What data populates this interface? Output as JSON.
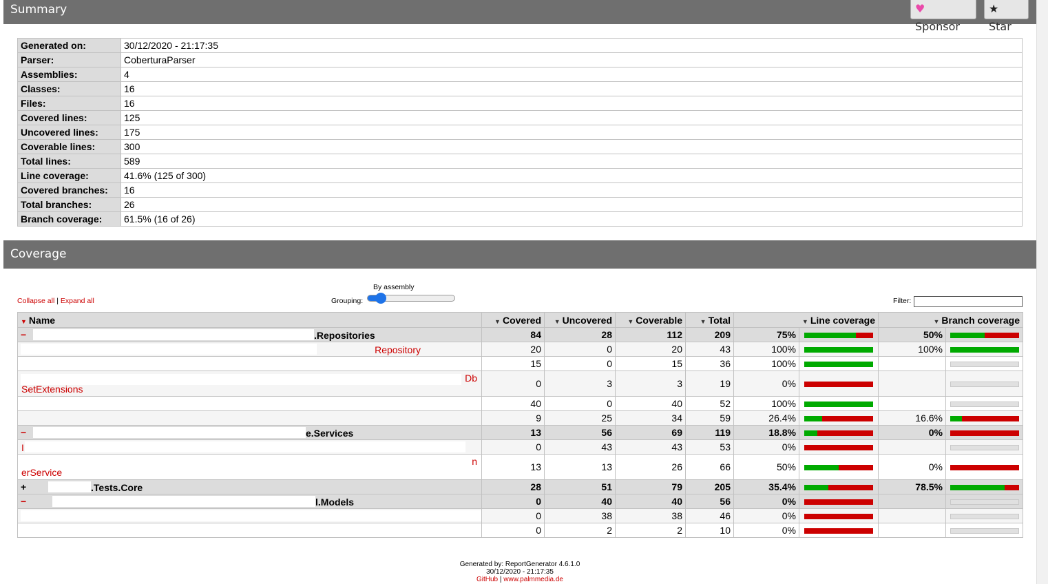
{
  "summary": {
    "title": "Summary",
    "sponsor_label": "Sponsor",
    "star_label": "Star",
    "rows": [
      {
        "k": "Generated on:",
        "v": "30/12/2020 - 21:17:35"
      },
      {
        "k": "Parser:",
        "v": "CoberturaParser"
      },
      {
        "k": "Assemblies:",
        "v": "4"
      },
      {
        "k": "Classes:",
        "v": "16"
      },
      {
        "k": "Files:",
        "v": "16"
      },
      {
        "k": "Covered lines:",
        "v": "125"
      },
      {
        "k": "Uncovered lines:",
        "v": "175"
      },
      {
        "k": "Coverable lines:",
        "v": "300"
      },
      {
        "k": "Total lines:",
        "v": "589"
      },
      {
        "k": "Line coverage:",
        "v": "41.6% (125 of 300)"
      },
      {
        "k": "Covered branches:",
        "v": "16"
      },
      {
        "k": "Total branches:",
        "v": "26"
      },
      {
        "k": "Branch coverage:",
        "v": "61.5% (16 of 26)"
      }
    ]
  },
  "coverage": {
    "title": "Coverage",
    "collapse_all": "Collapse all",
    "separator": "|",
    "expand_all": "Expand all",
    "grouping_label": "Grouping:",
    "grouping_value": "By assembly",
    "grouping_level": 0.1,
    "filter_label": "Filter:",
    "columns": [
      "Name",
      "Covered",
      "Uncovered",
      "Coverable",
      "Total",
      "Line coverage",
      "Branch coverage"
    ],
    "rows": [
      {
        "type": "asm",
        "toggle": "−",
        "name": ".Repositories",
        "covered": "84",
        "uncovered": "28",
        "coverable": "112",
        "total": "209",
        "line_pct": "75%",
        "line_frac": 0.75,
        "branch_pct": "50%",
        "branch_frac": 0.5
      },
      {
        "type": "cls",
        "name": "Repository",
        "covered": "20",
        "uncovered": "0",
        "coverable": "20",
        "total": "43",
        "line_pct": "100%",
        "line_frac": 1.0,
        "branch_pct": "100%",
        "branch_frac": 1.0
      },
      {
        "type": "cls",
        "name": "",
        "covered": "15",
        "uncovered": "0",
        "coverable": "15",
        "total": "36",
        "line_pct": "100%",
        "line_frac": 1.0,
        "branch_pct": "",
        "branch_frac": null
      },
      {
        "type": "cls",
        "tall": true,
        "name": "SetExtensions",
        "name_top": "Db",
        "covered": "0",
        "uncovered": "3",
        "coverable": "3",
        "total": "19",
        "line_pct": "0%",
        "line_frac": 0.0,
        "branch_pct": "",
        "branch_frac": null
      },
      {
        "type": "cls",
        "name": "",
        "covered": "40",
        "uncovered": "0",
        "coverable": "40",
        "total": "52",
        "line_pct": "100%",
        "line_frac": 1.0,
        "branch_pct": "",
        "branch_frac": null
      },
      {
        "type": "cls",
        "name": "",
        "covered": "9",
        "uncovered": "25",
        "coverable": "34",
        "total": "59",
        "line_pct": "26.4%",
        "line_frac": 0.264,
        "branch_pct": "16.6%",
        "branch_frac": 0.166
      },
      {
        "type": "asm",
        "toggle": "−",
        "name": "e.Services",
        "covered": "13",
        "uncovered": "56",
        "coverable": "69",
        "total": "119",
        "line_pct": "18.8%",
        "line_frac": 0.188,
        "branch_pct": "0%",
        "branch_frac": 0.0
      },
      {
        "type": "cls",
        "name": "I",
        "covered": "0",
        "uncovered": "43",
        "coverable": "43",
        "total": "53",
        "line_pct": "0%",
        "line_frac": 0.0,
        "branch_pct": "",
        "branch_frac": null
      },
      {
        "type": "cls",
        "tall": true,
        "name": "erService",
        "name_top": "n",
        "covered": "13",
        "uncovered": "13",
        "coverable": "26",
        "total": "66",
        "line_pct": "50%",
        "line_frac": 0.5,
        "branch_pct": "0%",
        "branch_frac": 0.0
      },
      {
        "type": "asm",
        "toggle": "+",
        "name": ".Tests.Core",
        "covered": "28",
        "uncovered": "51",
        "coverable": "79",
        "total": "205",
        "line_pct": "35.4%",
        "line_frac": 0.354,
        "branch_pct": "78.5%",
        "branch_frac": 0.785
      },
      {
        "type": "asm",
        "toggle": "−",
        "name": "l.Models",
        "covered": "0",
        "uncovered": "40",
        "coverable": "40",
        "total": "56",
        "line_pct": "0%",
        "line_frac": 0.0,
        "branch_pct": "",
        "branch_frac": null
      },
      {
        "type": "cls",
        "name": "",
        "covered": "0",
        "uncovered": "38",
        "coverable": "38",
        "total": "46",
        "line_pct": "0%",
        "line_frac": 0.0,
        "branch_pct": "",
        "branch_frac": null
      },
      {
        "type": "cls",
        "name": "",
        "covered": "0",
        "uncovered": "2",
        "coverable": "2",
        "total": "10",
        "line_pct": "0%",
        "line_frac": 0.0,
        "branch_pct": "",
        "branch_frac": null
      }
    ]
  },
  "footer": {
    "generated_by": "Generated by: ReportGenerator 4.6.1.0",
    "date": "30/12/2020 - 21:17:35",
    "github": "GitHub",
    "sep": "|",
    "site": "www.palmmedia.de"
  },
  "colors": {
    "header": "#6f6f6f",
    "covered": "#00aa00",
    "uncovered": "#cc0000",
    "sponsor_heart": "#ea4aaa"
  },
  "icons": {
    "sponsor": "heart-icon",
    "star": "star-icon",
    "sort": "sort-down-icon"
  }
}
